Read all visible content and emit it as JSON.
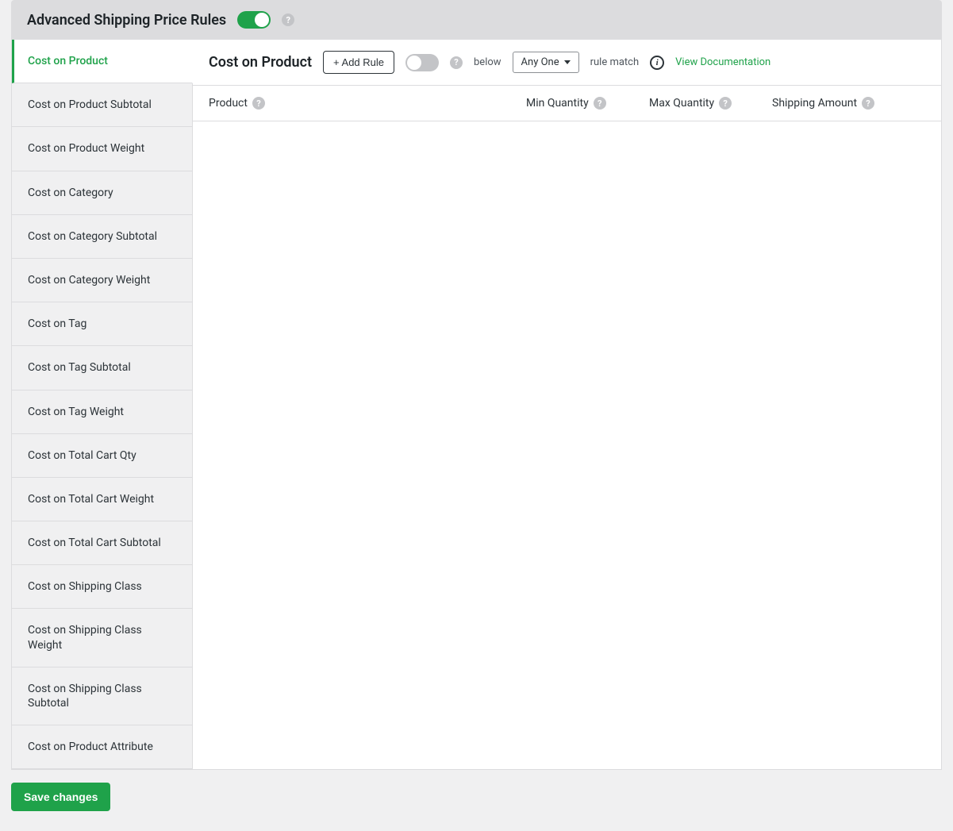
{
  "header": {
    "title": "Advanced Shipping Price Rules",
    "toggle_on": true
  },
  "sidebar": {
    "tabs": [
      {
        "label": "Cost on Product",
        "active": true
      },
      {
        "label": "Cost on Product Subtotal",
        "active": false
      },
      {
        "label": "Cost on Product Weight",
        "active": false
      },
      {
        "label": "Cost on Category",
        "active": false
      },
      {
        "label": "Cost on Category Subtotal",
        "active": false
      },
      {
        "label": "Cost on Category Weight",
        "active": false
      },
      {
        "label": "Cost on Tag",
        "active": false
      },
      {
        "label": "Cost on Tag Subtotal",
        "active": false
      },
      {
        "label": "Cost on Tag Weight",
        "active": false
      },
      {
        "label": "Cost on Total Cart Qty",
        "active": false
      },
      {
        "label": "Cost on Total Cart Weight",
        "active": false
      },
      {
        "label": "Cost on Total Cart Subtotal",
        "active": false
      },
      {
        "label": "Cost on Shipping Class",
        "active": false
      },
      {
        "label": "Cost on Shipping Class Weight",
        "active": false
      },
      {
        "label": "Cost on Shipping Class Subtotal",
        "active": false
      },
      {
        "label": "Cost on Product Attribute",
        "active": false
      }
    ]
  },
  "main": {
    "title": "Cost on Product",
    "add_rule_label": "+ Add Rule",
    "toggle_on": false,
    "below_label": "below",
    "match_select": "Any One",
    "rule_match_label": "rule match",
    "doc_link": "View Documentation",
    "columns": {
      "product": "Product",
      "min_qty": "Min Quantity",
      "max_qty": "Max Quantity",
      "shipping_amount": "Shipping Amount"
    }
  },
  "footer": {
    "save_label": "Save changes"
  }
}
